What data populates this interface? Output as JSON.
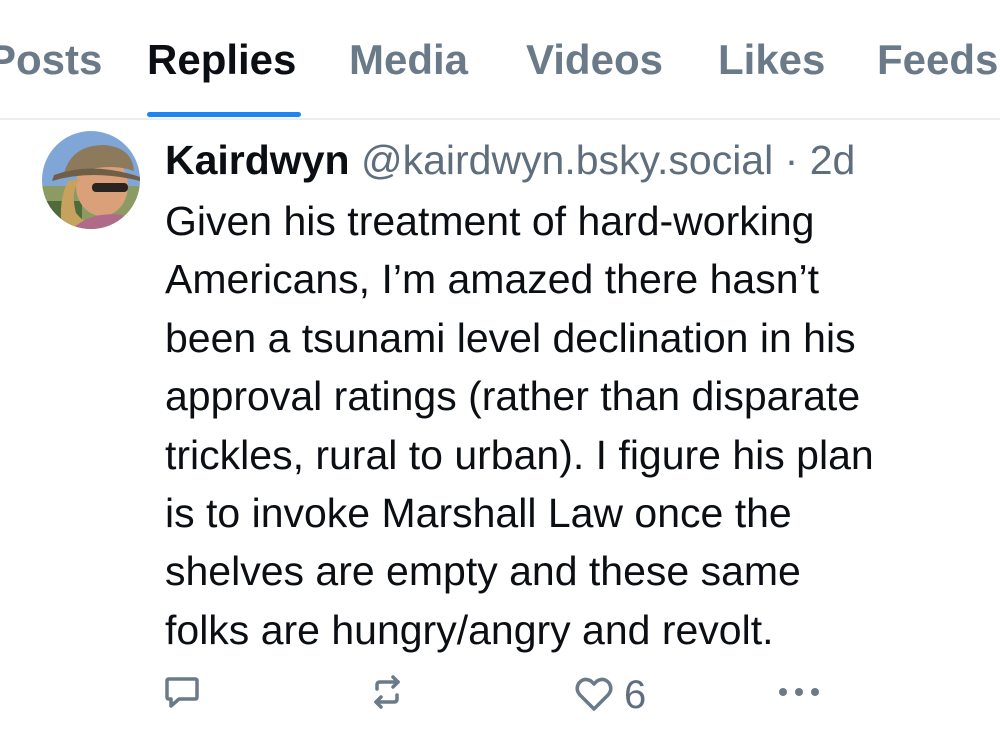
{
  "tabs": [
    {
      "label": "Posts"
    },
    {
      "label": "Replies"
    },
    {
      "label": "Media"
    },
    {
      "label": "Videos"
    },
    {
      "label": "Likes"
    },
    {
      "label": "Feeds"
    }
  ],
  "active_tab": "Replies",
  "post": {
    "display_name": "Kairdwyn",
    "handle": "@kairdwyn.bsky.social",
    "separator": "·",
    "time": "2d",
    "text_lines": [
      "Given his treatment of hard-working",
      "Americans, I’m amazed there hasn’t",
      "been a tsunami level declination in his",
      "approval ratings (rather than disparate",
      "trickles, rural to urban). I figure his plan",
      "is to invoke Marshall Law once the",
      "shelves are empty and these same",
      "folks are hungry/angry and revolt."
    ],
    "like_count": "6"
  },
  "icons": {
    "reply": "reply-icon",
    "repost": "repost-icon",
    "like": "heart-icon",
    "more": "more-icon"
  },
  "colors": {
    "accent": "#1d84f0",
    "text": "#0b0f14",
    "muted": "#5f6e7d"
  }
}
